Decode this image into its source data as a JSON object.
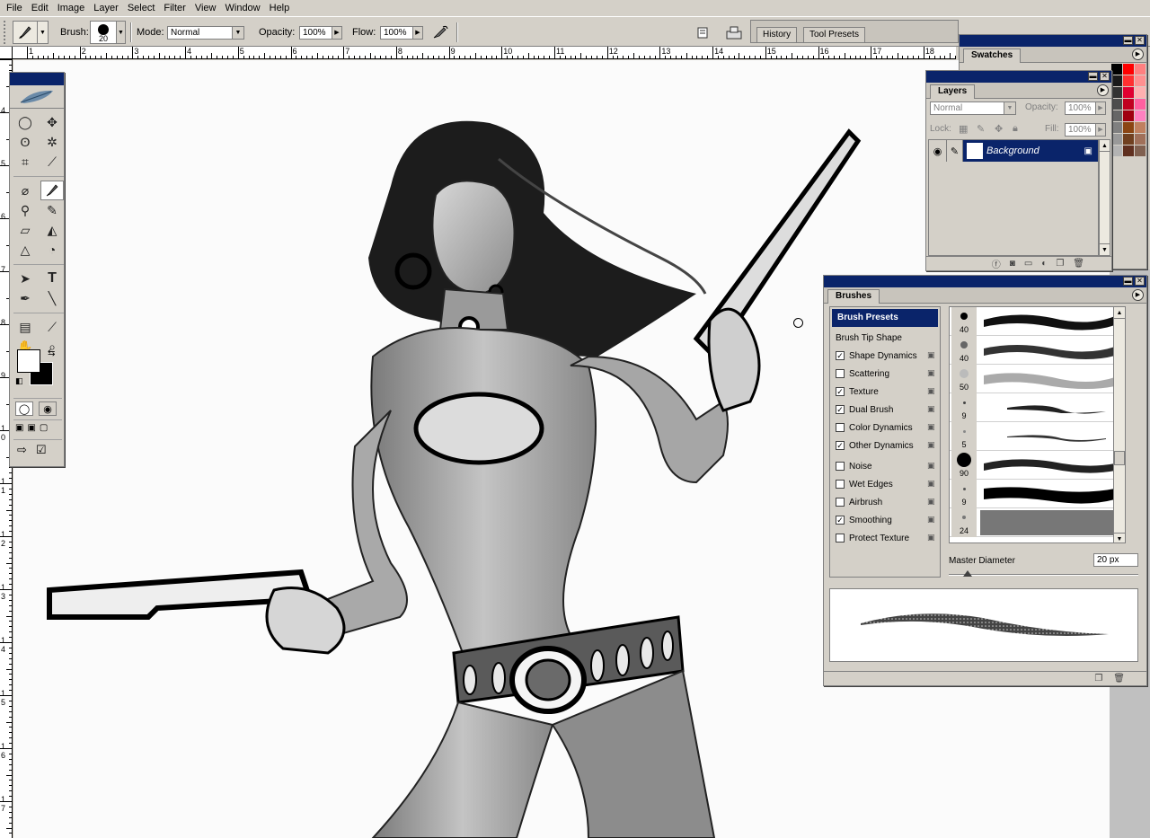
{
  "menu": [
    "File",
    "Edit",
    "Image",
    "Layer",
    "Select",
    "Filter",
    "View",
    "Window",
    "Help"
  ],
  "options": {
    "brush_label": "Brush:",
    "brush_size": "20",
    "mode_label": "Mode:",
    "mode_value": "Normal",
    "opacity_label": "Opacity:",
    "opacity_value": "100%",
    "flow_label": "Flow:",
    "flow_value": "100%"
  },
  "well_tabs": [
    "History",
    "Tool Presets"
  ],
  "ruler": {
    "h_labels": [
      "1",
      "2",
      "3",
      "4",
      "5",
      "6",
      "7",
      "8",
      "9",
      "10",
      "11",
      "12",
      "13",
      "14",
      "15",
      "16",
      "17",
      "18"
    ],
    "v_labels": [
      "4",
      "5",
      "6",
      "7",
      "8",
      "9",
      "1 0",
      "1 1",
      "1 2",
      "1 3",
      "1 4",
      "1 5",
      "1 6",
      "1 7"
    ]
  },
  "swatches": {
    "tab": "Swatches",
    "colors": [
      "#000000",
      "#ff0000",
      "#ff8080",
      "#1a1a1a",
      "#ff3030",
      "#ff9090",
      "#333333",
      "#e00030",
      "#ffb0b0",
      "#4d4d4d",
      "#c00020",
      "#ff60a0",
      "#666666",
      "#a00010",
      "#ff80c0",
      "#808080",
      "#8b4513",
      "#c08060",
      "#999999",
      "#704020",
      "#a0705a",
      "#b3b3b3",
      "#603020",
      "#806050"
    ]
  },
  "layers": {
    "tab": "Layers",
    "blend_mode": "Normal",
    "opacity_label": "Opacity:",
    "opacity_value": "100%",
    "lock_label": "Lock:",
    "fill_label": "Fill:",
    "fill_value": "100%",
    "layer_name": "Background"
  },
  "brushes": {
    "tab": "Brushes",
    "presets_label": "Brush Presets",
    "tip_shape_label": "Brush Tip Shape",
    "options": [
      {
        "label": "Shape Dynamics",
        "checked": true
      },
      {
        "label": "Scattering",
        "checked": false
      },
      {
        "label": "Texture",
        "checked": true
      },
      {
        "label": "Dual Brush",
        "checked": true
      },
      {
        "label": "Color Dynamics",
        "checked": false
      },
      {
        "label": "Other Dynamics",
        "checked": true
      },
      {
        "label": "Noise",
        "checked": false
      },
      {
        "label": "Wet Edges",
        "checked": false
      },
      {
        "label": "Airbrush",
        "checked": false
      },
      {
        "label": "Smoothing",
        "checked": true
      },
      {
        "label": "Protect Texture",
        "checked": false
      }
    ],
    "sizes": [
      "40",
      "40",
      "50",
      "9",
      "5",
      "90",
      "9",
      "24"
    ],
    "master_label": "Master Diameter",
    "master_value": "20 px"
  },
  "icons": {
    "brush": "paintbrush-icon",
    "airbrush": "airbrush-icon"
  }
}
